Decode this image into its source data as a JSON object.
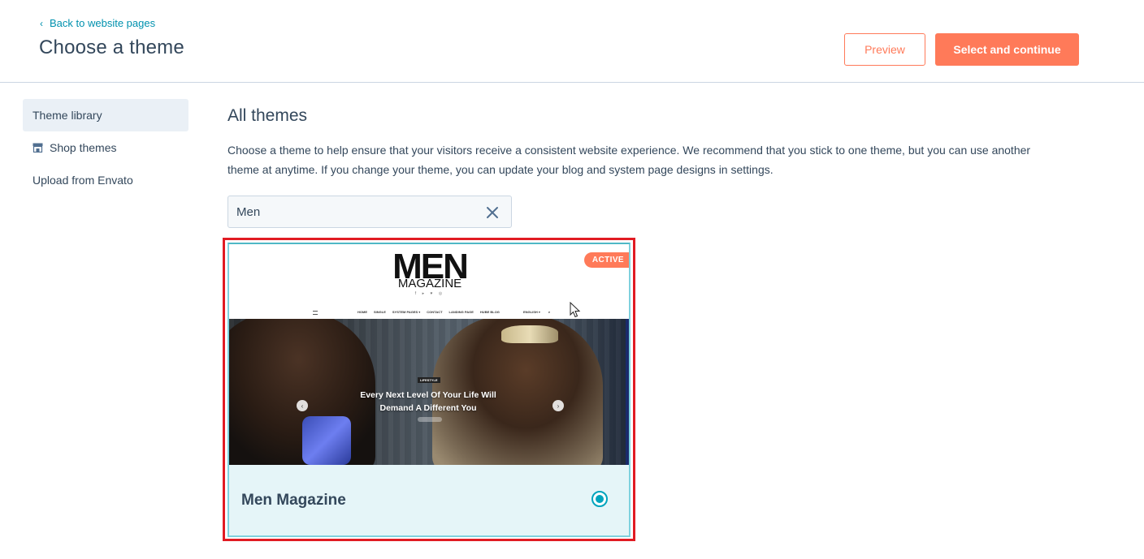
{
  "header": {
    "back_label": "Back to website pages",
    "title": "Choose a theme",
    "preview_label": "Preview",
    "select_label": "Select and continue"
  },
  "sidebar": {
    "items": [
      {
        "label": "Theme library",
        "active": true
      },
      {
        "label": "Shop themes",
        "icon": "store-icon"
      },
      {
        "label": "Upload from Envato"
      }
    ]
  },
  "main": {
    "heading": "All themes",
    "description": "Choose a theme to help ensure that your visitors receive a consistent website experience. We recommend that you stick to one theme, but you can use another theme at anytime. If you change your theme, you can update your blog and system page designs in settings.",
    "search_value": "Men"
  },
  "theme_card": {
    "name": "Men Magazine",
    "badge": "ACTIVE",
    "selected": true,
    "preview": {
      "logo_line1": "MEN",
      "logo_line2": "MAGAZINE",
      "social": "f  ▸  ♥  ◎",
      "nav_items": [
        "HOME",
        "SINGLE",
        "SYSTEM PAGES ▾",
        "CONTACT",
        "LANDING PAGE",
        "HUBE BLOG"
      ],
      "nav_right": [
        "ENGLISH ▾",
        "⌕"
      ],
      "tag": "LIFESTYLE",
      "headline": "Every Next Level Of Your Life Will Demand A Different You"
    }
  },
  "colors": {
    "accent": "#ff7a59",
    "link": "#0091ae",
    "selected": "#00a4bd",
    "highlight": "#e11b23"
  }
}
